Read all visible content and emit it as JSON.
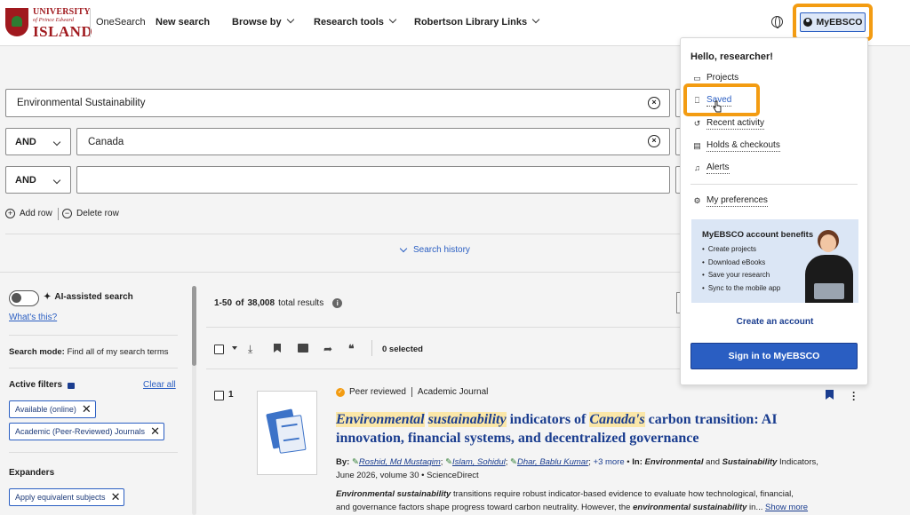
{
  "brand": {
    "logo_line1": "UNIVERSITY",
    "logo_line2": "of Prince Edward",
    "logo_line3": "ISLAND"
  },
  "nav": {
    "onesearch": "OneSearch",
    "new_search": "New search",
    "browse_by": "Browse by",
    "research_tools": "Research tools",
    "robertson_links": "Robertson Library Links",
    "myebsco": "MyEBSCO"
  },
  "search": {
    "row1_value": "Environmental Sustainability",
    "row2_operator": "AND",
    "row2_value": "Canada",
    "row3_operator": "AND",
    "row3_value": "",
    "add_row": "Add row",
    "delete_row": "Delete row",
    "search_history": "Search history"
  },
  "filters": {
    "ai_label": "AI-assisted search",
    "whats_this": "What's this?",
    "search_mode_label": "Search mode:",
    "search_mode_value": "Find all of my search terms",
    "active_filters": "Active filters",
    "clear_all": "Clear all",
    "chips": [
      "Available (online)",
      "Academic (Peer-Reviewed) Journals"
    ],
    "expanders": "Expanders",
    "expander_chips": [
      "Apply equivalent subjects"
    ]
  },
  "results": {
    "range": "1-50",
    "of_word": "of",
    "total": "38,008",
    "total_label": "total results",
    "selected": "0 selected",
    "item": {
      "number": "1",
      "peer_reviewed": "Peer reviewed",
      "source_type": "Academic Journal",
      "title_parts": [
        "Environmental",
        "sustainability",
        "indicators of",
        "Canada's",
        "carbon transition: AI innovation, financial systems, and decentralized governance"
      ],
      "by": "By:",
      "authors": [
        "Roshid, Md Mustaqim",
        "Islam, Sohidul",
        "Dhar, Bablu Kumar"
      ],
      "more_authors": "+3 more",
      "in_label": "In:",
      "journal_1": "Environmental",
      "journal_and": "and",
      "journal_2": "Sustainability",
      "journal_3": "Indicators,",
      "pub_line": "June 2026, volume 30 • ScienceDirect",
      "abstract_a": "Environmental sustainability",
      "abstract_b": "transitions require robust indicator-based evidence to evaluate how technological, financial,",
      "abstract_c": "and governance factors shape progress toward carbon neutrality. However, the",
      "abstract_d": "environmental sustainability",
      "abstract_e": "in...",
      "show_more": "Show more"
    }
  },
  "dropdown": {
    "greeting": "Hello, researcher!",
    "items": [
      "Projects",
      "Saved",
      "Recent activity",
      "Holds & checkouts",
      "Alerts"
    ],
    "preferences": "My preferences",
    "benefits_title": "MyEBSCO account benefits",
    "benefits": [
      "Create projects",
      "Download eBooks",
      "Save your research",
      "Sync to the mobile app"
    ],
    "create_account": "Create an account",
    "sign_in": "Sign in to MyEBSCO"
  },
  "colors": {
    "accent_blue": "#2a5ec2",
    "title_blue": "#1a3d8f",
    "highlight_orange": "#f39c12",
    "brand_red": "#a0191e"
  }
}
